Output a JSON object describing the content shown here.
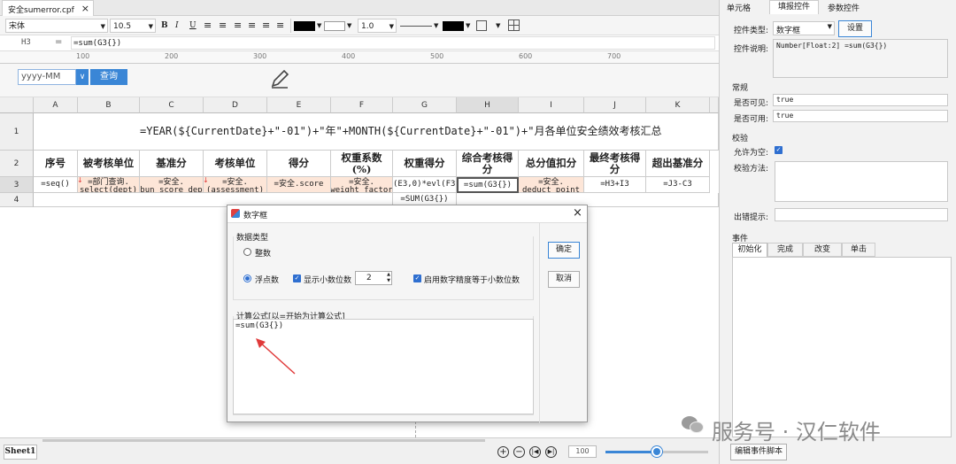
{
  "tab": {
    "title": "安全sumerror.cpf",
    "close": "×"
  },
  "toolbar": {
    "font": "宋体",
    "size": "10.5",
    "line_spacing": "1.0"
  },
  "formula_bar": {
    "cell_ref": "H3",
    "eq": "=",
    "formula": "=sum(G3{})"
  },
  "ruler_marks": [
    "100",
    "200",
    "300",
    "400",
    "500",
    "600",
    "700"
  ],
  "param": {
    "date_placeholder": "yyyy-MM",
    "query_label": "查询"
  },
  "grid": {
    "columns": [
      "A",
      "B",
      "C",
      "D",
      "E",
      "F",
      "G",
      "H",
      "I",
      "J",
      "K"
    ],
    "rows": [
      "1",
      "2",
      "3",
      "4"
    ],
    "title_formula": "=YEAR(${CurrentDate}+\"-01\")+\"年\"+MONTH(${CurrentDate}+\"-01\")+\"月各单位安全绩效考核汇总",
    "headers": [
      "序号",
      "被考核单位",
      "基准分",
      "考核单位",
      "得分",
      "权重系数\n(%)",
      "权重得分",
      "综合考核得\n分",
      "总分值扣分",
      "最终考核得\n分",
      "超出基准分"
    ],
    "row3": [
      "=seq()",
      "=部门查询.\nselect(dept)",
      "=安全.\nibun_score_dept",
      "=安全.\n(assessment)",
      "=安全.score",
      "=安全.\nweight_factor",
      "(E3,0)*evl(F3,",
      "=sum(G3{})",
      "=安全.\ndeduct_point",
      "=H3+I3",
      "=J3-C3"
    ],
    "row4_g": "=SUM(G3{})"
  },
  "bottom": {
    "sheet_tab": "Sheet1",
    "zoom": "100"
  },
  "right_panel": {
    "tabs": [
      "单元格",
      "填报控件",
      "参数控件"
    ],
    "control_type_label": "控件类型:",
    "control_type_value": "数字框",
    "settings_button": "设置",
    "control_desc_label": "控件说明:",
    "control_desc_value": "Number[Float:2] =sum(G3{})",
    "general_section": "常规",
    "visible_label": "是否可见:",
    "visible_value": "true",
    "enabled_label": "是否可用:",
    "enabled_value": "true",
    "validate_section": "校验",
    "allow_empty_label": "允许为空:",
    "validate_method_label": "校验方法:",
    "error_hint_label": "出错提示:",
    "events_section": "事件",
    "event_tabs": [
      "初始化",
      "完成",
      "改变",
      "单击"
    ],
    "edit_script_button": "编辑事件脚本"
  },
  "dialog": {
    "title": "数字框",
    "close": "×",
    "datatype_group": "数据类型",
    "integer_label": "整数",
    "float_label": "浮点数",
    "show_decimals_label": "显示小数位数",
    "decimals_value": "2",
    "precision_label": "启用数字精度等于小数位数",
    "formula_group": "计算公式[以=开始为计算公式]",
    "formula_value": "=sum(G3{})",
    "ok_button": "确定",
    "cancel_button": "取消"
  },
  "watermark": {
    "text": "服务号 · 汉仁软件"
  },
  "colors": {
    "accent_blue": "#3a86d6",
    "arrow_red": "#e03a3a",
    "row3_fill": "#fde6d8"
  }
}
